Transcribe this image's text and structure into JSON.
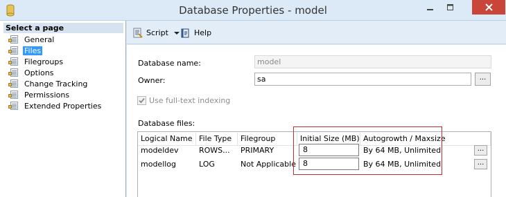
{
  "window": {
    "title": "Database Properties - model",
    "close_glyph": "✕",
    "min_glyph": "—",
    "max_glyph": "☐"
  },
  "sidebar": {
    "header": "Select a page",
    "items": [
      {
        "label": "General",
        "icon": "page-icon"
      },
      {
        "label": "Files",
        "icon": "page-icon",
        "selected": true
      },
      {
        "label": "Filegroups",
        "icon": "page-icon"
      },
      {
        "label": "Options",
        "icon": "page-icon"
      },
      {
        "label": "Change Tracking",
        "icon": "page-icon"
      },
      {
        "label": "Permissions",
        "icon": "page-icon"
      },
      {
        "label": "Extended Properties",
        "icon": "page-icon"
      }
    ]
  },
  "toolbar": {
    "script_label": "Script",
    "help_label": "Help"
  },
  "form": {
    "database_name_label": "Database name:",
    "database_name_value": "model",
    "owner_label": "Owner:",
    "owner_value": "sa",
    "browse_label": "...",
    "fulltext_label": "Use full-text indexing",
    "fulltext_checked": true,
    "database_files_label": "Database files:"
  },
  "files_table": {
    "headers": [
      "Logical Name",
      "File Type",
      "Filegroup",
      "Initial Size (MB)",
      "Autogrowth / Maxsize"
    ],
    "rows": [
      {
        "logical_name": "modeldev",
        "file_type": "ROWS...",
        "filegroup": "PRIMARY",
        "initial_size": "8",
        "autogrowth": "By 64 MB, Unlimited",
        "button": "..."
      },
      {
        "logical_name": "modellog",
        "file_type": "LOG",
        "filegroup": "Not Applicable",
        "initial_size": "8",
        "autogrowth": "By 64 MB, Unlimited",
        "button": "..."
      }
    ]
  },
  "colors": {
    "selection": "#3399ff",
    "highlight_border": "#c42b2b",
    "close_button": "#c9453a"
  }
}
